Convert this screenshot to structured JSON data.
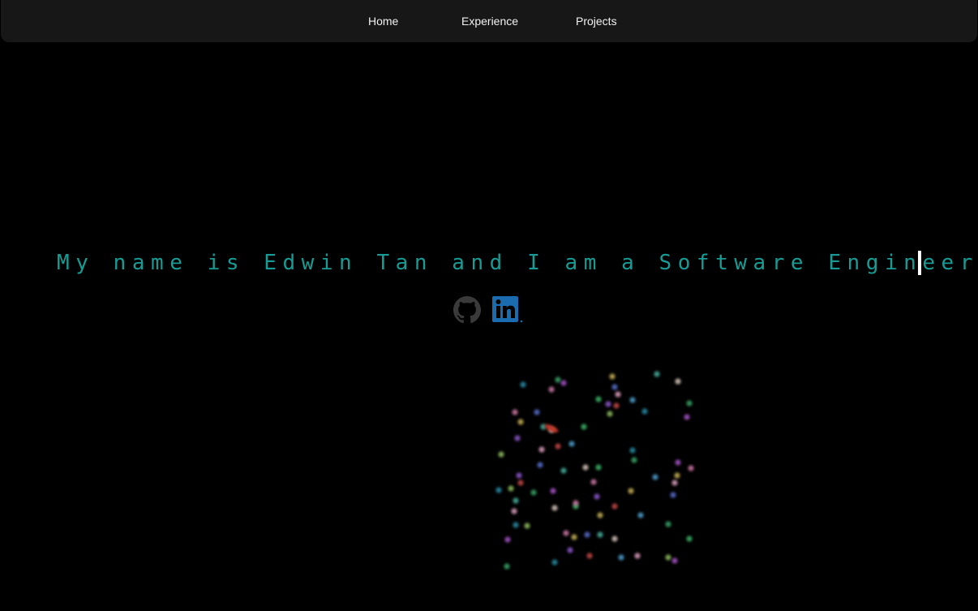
{
  "nav": {
    "items": [
      {
        "label": "Home"
      },
      {
        "label": "Experience"
      },
      {
        "label": "Projects"
      }
    ]
  },
  "hero": {
    "typed_text": "My name is Edwin Tan and I am a Software Engineer",
    "accent_color": "#169c94"
  },
  "social": {
    "github_icon": "github-icon",
    "linkedin_icon": "linkedin-icon",
    "linkedin_color": "#1a6bb0"
  }
}
